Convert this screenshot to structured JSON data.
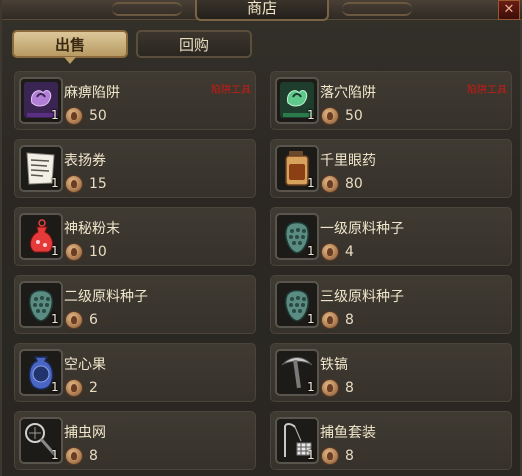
{
  "header": {
    "title": "商店",
    "close_icon": "close-x-icon"
  },
  "tabs": [
    {
      "label": "出售",
      "active": true
    },
    {
      "label": "回购",
      "active": false
    }
  ],
  "colors": {
    "tag_red": "#c81a14",
    "tab_active": "#cdb47f",
    "coin": "#b5835a"
  },
  "items": [
    {
      "name": "麻痹陷阱",
      "count": "1",
      "price": "50",
      "tag": "陷阱工具",
      "icon": "paralysis-trap-icon"
    },
    {
      "name": "落穴陷阱",
      "count": "1",
      "price": "50",
      "tag": "陷阱工具",
      "icon": "pitfall-trap-icon"
    },
    {
      "name": "表扬券",
      "count": "1",
      "price": "15",
      "tag": "",
      "icon": "commendation-ticket-icon"
    },
    {
      "name": "千里眼药",
      "count": "1",
      "price": "80",
      "tag": "",
      "icon": "psychoserum-icon"
    },
    {
      "name": "神秘粉末",
      "count": "1",
      "price": "10",
      "tag": "",
      "icon": "mystery-powder-icon"
    },
    {
      "name": "一级原料种子",
      "count": "1",
      "price": "4",
      "tag": "",
      "icon": "seed-level1-icon"
    },
    {
      "name": "二级原料种子",
      "count": "1",
      "price": "6",
      "tag": "",
      "icon": "seed-level2-icon"
    },
    {
      "name": "三级原料种子",
      "count": "1",
      "price": "8",
      "tag": "",
      "icon": "seed-level3-icon"
    },
    {
      "name": "空心果",
      "count": "1",
      "price": "2",
      "tag": "",
      "icon": "hollow-fruit-icon"
    },
    {
      "name": "铁镐",
      "count": "1",
      "price": "8",
      "tag": "",
      "icon": "iron-pickaxe-icon"
    },
    {
      "name": "捕虫网",
      "count": "1",
      "price": "8",
      "tag": "",
      "icon": "bug-net-icon"
    },
    {
      "name": "捕鱼套装",
      "count": "1",
      "price": "8",
      "tag": "",
      "icon": "fishing-kit-icon"
    }
  ]
}
